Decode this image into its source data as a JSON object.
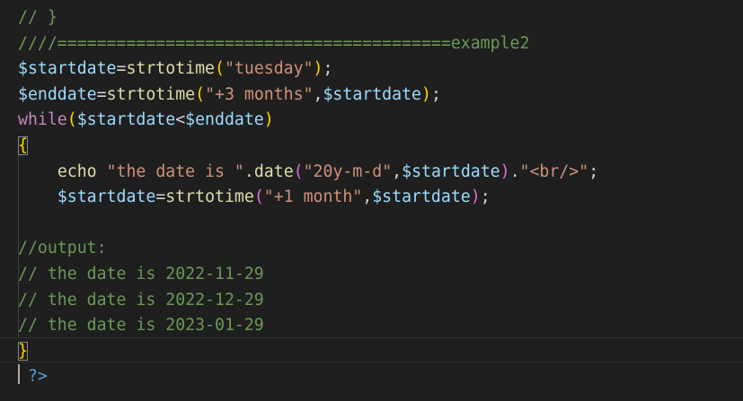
{
  "colors": {
    "background": "#1f1f1f",
    "comment": "#6a9955",
    "variable": "#9cdcfe",
    "function": "#dcdcaa",
    "string": "#ce9178",
    "keyword": "#c586c0",
    "bracket": "#ffd700",
    "bracket_inner": "#da70d6",
    "text": "#d4d4d4",
    "php_tag": "#569cd6"
  },
  "code_lines": [
    {
      "tokens": [
        {
          "t": "// }",
          "c": "comment"
        }
      ]
    },
    {
      "tokens": [
        {
          "t": "////========================================example2",
          "c": "comment"
        }
      ]
    },
    {
      "tokens": [
        {
          "t": "$startdate",
          "c": "variable"
        },
        {
          "t": "=",
          "c": "text"
        },
        {
          "t": "strtotime",
          "c": "function"
        },
        {
          "t": "(",
          "c": "bracket"
        },
        {
          "t": "\"tuesday\"",
          "c": "string"
        },
        {
          "t": ")",
          "c": "bracket"
        },
        {
          "t": ";",
          "c": "text"
        }
      ]
    },
    {
      "tokens": [
        {
          "t": "$enddate",
          "c": "variable"
        },
        {
          "t": "=",
          "c": "text"
        },
        {
          "t": "strtotime",
          "c": "function"
        },
        {
          "t": "(",
          "c": "bracket"
        },
        {
          "t": "\"+3 months\"",
          "c": "string"
        },
        {
          "t": ",",
          "c": "text"
        },
        {
          "t": "$startdate",
          "c": "variable"
        },
        {
          "t": ")",
          "c": "bracket"
        },
        {
          "t": ";",
          "c": "text"
        }
      ]
    },
    {
      "tokens": [
        {
          "t": "while",
          "c": "keyword"
        },
        {
          "t": "(",
          "c": "bracket"
        },
        {
          "t": "$startdate",
          "c": "variable"
        },
        {
          "t": "<",
          "c": "text"
        },
        {
          "t": "$enddate",
          "c": "variable"
        },
        {
          "t": ")",
          "c": "bracket"
        }
      ]
    },
    {
      "tokens": [
        {
          "t": "{",
          "c": "bracket",
          "box": true
        }
      ]
    },
    {
      "tokens": [
        {
          "t": "    ",
          "c": "text"
        },
        {
          "t": "echo",
          "c": "function"
        },
        {
          "t": " ",
          "c": "text"
        },
        {
          "t": "\"the date is \"",
          "c": "string"
        },
        {
          "t": ".",
          "c": "text"
        },
        {
          "t": "date",
          "c": "function"
        },
        {
          "t": "(",
          "c": "bracket_inner"
        },
        {
          "t": "\"20y-m-d\"",
          "c": "string"
        },
        {
          "t": ",",
          "c": "text"
        },
        {
          "t": "$startdate",
          "c": "variable"
        },
        {
          "t": ")",
          "c": "bracket_inner"
        },
        {
          "t": ".",
          "c": "text"
        },
        {
          "t": "\"<br/>\"",
          "c": "string"
        },
        {
          "t": ";",
          "c": "text"
        }
      ]
    },
    {
      "tokens": [
        {
          "t": "    ",
          "c": "text"
        },
        {
          "t": "$startdate",
          "c": "variable"
        },
        {
          "t": "=",
          "c": "text"
        },
        {
          "t": "strtotime",
          "c": "function"
        },
        {
          "t": "(",
          "c": "bracket_inner"
        },
        {
          "t": "\"+1 month\"",
          "c": "string"
        },
        {
          "t": ",",
          "c": "text"
        },
        {
          "t": "$startdate",
          "c": "variable"
        },
        {
          "t": ")",
          "c": "bracket_inner"
        },
        {
          "t": ";",
          "c": "text"
        }
      ]
    },
    {
      "tokens": []
    },
    {
      "tokens": [
        {
          "t": "//output:",
          "c": "comment"
        }
      ]
    },
    {
      "tokens": [
        {
          "t": "// the date is 2022-11-29",
          "c": "comment"
        }
      ]
    },
    {
      "tokens": [
        {
          "t": "// the date is 2022-12-29",
          "c": "comment"
        }
      ]
    },
    {
      "tokens": [
        {
          "t": "// the date is 2023-01-29",
          "c": "comment"
        }
      ]
    },
    {
      "tokens": [
        {
          "t": "}",
          "c": "bracket",
          "box": true
        }
      ]
    },
    {
      "tokens": [
        {
          "t": " ",
          "c": "text"
        },
        {
          "t": "?>",
          "c": "php_tag"
        }
      ]
    }
  ]
}
